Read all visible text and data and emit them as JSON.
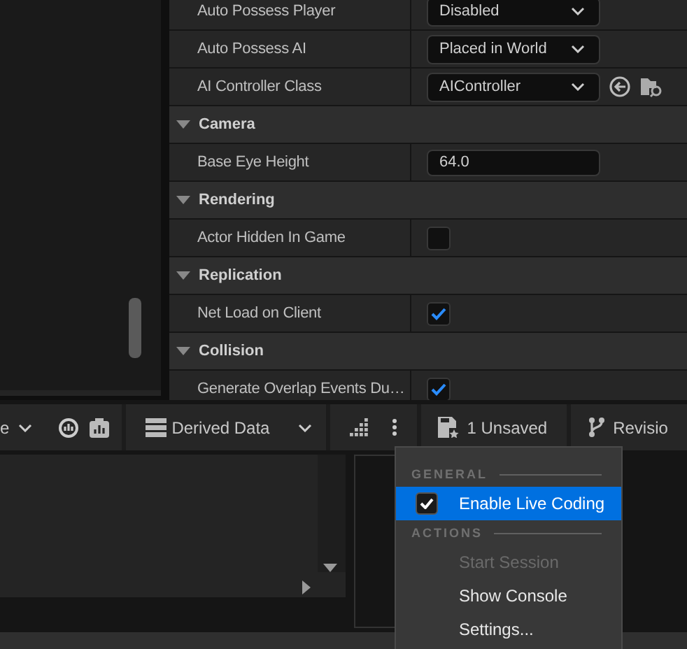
{
  "details": {
    "rows": [
      {
        "kind": "dropdown",
        "label": "Auto Possess Player",
        "value": "Disabled"
      },
      {
        "kind": "dropdown",
        "label": "Auto Possess AI",
        "value": "Placed in World"
      },
      {
        "kind": "class",
        "label": "AI Controller Class",
        "value": "AIController"
      },
      {
        "kind": "header",
        "label": "Camera",
        "expanded": true
      },
      {
        "kind": "number",
        "label": "Base Eye Height",
        "value": "64.0"
      },
      {
        "kind": "header",
        "label": "Rendering",
        "expanded": true
      },
      {
        "kind": "checkbox",
        "label": "Actor Hidden In Game",
        "checked": false
      },
      {
        "kind": "header",
        "label": "Replication",
        "expanded": true
      },
      {
        "kind": "checkbox",
        "label": "Net Load on Client",
        "checked": true
      },
      {
        "kind": "header",
        "label": "Collision",
        "expanded": true
      },
      {
        "kind": "checkbox",
        "label": "Generate Overlap Events Du…",
        "checked": true
      }
    ]
  },
  "toolbar": {
    "mode_label": "e",
    "derived_data": "Derived Data",
    "unsaved": "1 Unsaved",
    "revision": "Revisio"
  },
  "menu": {
    "sections": [
      {
        "title": "GENERAL",
        "items": [
          {
            "label": "Enable Live Coding",
            "kind": "check",
            "checked": true,
            "selected": true,
            "disabled": false
          }
        ]
      },
      {
        "title": "ACTIONS",
        "items": [
          {
            "label": "Start Session",
            "kind": "plain",
            "selected": false,
            "disabled": true
          },
          {
            "label": "Show Console",
            "kind": "plain",
            "selected": false,
            "disabled": false
          },
          {
            "label": "Settings...",
            "kind": "plain",
            "selected": false,
            "disabled": false
          }
        ]
      }
    ]
  }
}
